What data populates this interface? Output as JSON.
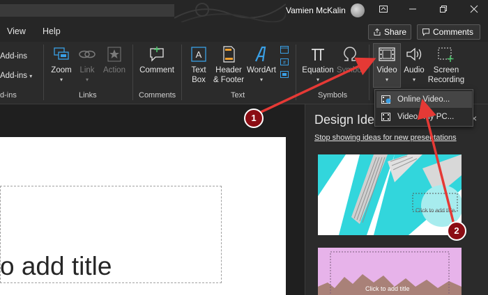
{
  "titlebar": {
    "user_name": "Vamien McKalin",
    "icons": [
      "ribbon-display-icon",
      "minimize-icon",
      "restore-icon",
      "close-icon"
    ]
  },
  "tabs": [
    {
      "label": "View"
    },
    {
      "label": "Help"
    }
  ],
  "top_buttons": {
    "share": "Share",
    "comments": "Comments"
  },
  "ribbon": {
    "addins_1": "Add-ins",
    "addins_2": "Add-ins",
    "addins_group": "d-ins",
    "zoom": "Zoom",
    "link": "Link",
    "action": "Action",
    "links_group": "Links",
    "comment": "Comment",
    "comments_group": "Comments",
    "text_box_1": "Text",
    "text_box_2": "Box",
    "header_1": "Header",
    "header_2": "& Footer",
    "wordart": "WordArt",
    "text_group": "Text",
    "equation": "Equation",
    "symbol": "Symbol",
    "symbols_group": "Symbols",
    "video": "Video",
    "audio": "Audio",
    "screen_1": "Screen",
    "screen_2": "Recording"
  },
  "dropdown": {
    "online_video": "Online Video...",
    "video_pc_1": "Video",
    "video_pc_2": "My PC..."
  },
  "slide": {
    "title_placeholder": "o add title"
  },
  "design_pane": {
    "title": "Design Ide",
    "close": "×",
    "stop_link": "Stop showing ideas for new presentations",
    "thumb1_text": "Click to add title",
    "thumb2_text": "Click to add title"
  },
  "annotations": {
    "marker_1": "1",
    "marker_2": "2",
    "arrow_color": "#e53935"
  },
  "colors": {
    "accent_blue": "#3aa0e6",
    "marker_fill": "#8b0d14",
    "thumb1_accent": "#32d6dc",
    "thumb2_bg": "#e7b3ea"
  }
}
